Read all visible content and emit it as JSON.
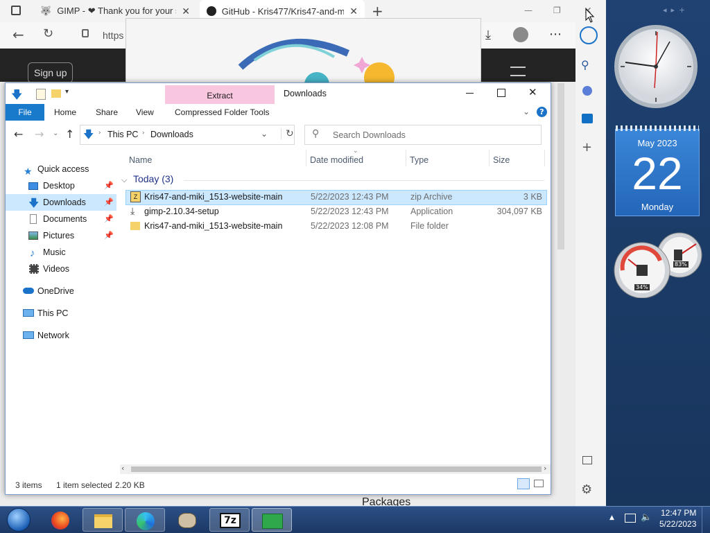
{
  "browser": {
    "tabs": [
      {
        "label": "GIMP - ❤ Thank you for your s",
        "close": "✕"
      },
      {
        "label": "GitHub - Kris477/Kris47-and-mi",
        "close": "✕"
      }
    ],
    "new_tab": "+",
    "address": "https",
    "sign_up": "Sign up",
    "packages_text": "Packages",
    "window_controls": {
      "minimize": "—",
      "restore": "❐",
      "close": "✕"
    }
  },
  "explorer": {
    "title": "Downloads",
    "context_tab": "Extract",
    "ribbon_tabs": [
      "File",
      "Home",
      "Share",
      "View",
      "Compressed Folder Tools"
    ],
    "breadcrumb": [
      "This PC",
      "Downloads"
    ],
    "search_placeholder": "Search Downloads",
    "nav": {
      "quick_access": "Quick access",
      "desktop": "Desktop",
      "downloads": "Downloads",
      "documents": "Documents",
      "pictures": "Pictures",
      "music": "Music",
      "videos": "Videos",
      "onedrive": "OneDrive",
      "this_pc": "This PC",
      "network": "Network"
    },
    "columns": {
      "name": "Name",
      "date": "Date modified",
      "type": "Type",
      "size": "Size"
    },
    "group_label": "Today (3)",
    "files": [
      {
        "name": "Kris47-and-miki_1513-website-main",
        "date": "5/22/2023 12:43 PM",
        "type": "zip Archive",
        "size": "3 KB",
        "icon": "zip-icon"
      },
      {
        "name": "gimp-2.10.34-setup",
        "date": "5/22/2023 12:43 PM",
        "type": "Application",
        "size": "304,097 KB",
        "icon": "installer-icon"
      },
      {
        "name": "Kris47-and-miki_1513-website-main",
        "date": "5/22/2023 12:08 PM",
        "type": "File folder",
        "size": "",
        "icon": "folder-icon"
      }
    ],
    "status": {
      "items": "3 items",
      "selected": "1 item selected",
      "size": "2.20 KB"
    }
  },
  "gadgets": {
    "calendar": {
      "month_year": "May 2023",
      "day": "22",
      "weekday": "Monday"
    },
    "meter": {
      "cpu": "34%",
      "memory": "83%"
    }
  },
  "taskbar": {
    "time": "12:47 PM",
    "date": "5/22/2023",
    "apps": [
      "start-orb",
      "firefox-icon",
      "file-explorer-icon",
      "edge-icon",
      "gimp-icon",
      "7zip-icon",
      "installer-icon"
    ],
    "sevenzip_label": "7z"
  },
  "colors": {
    "accent": "#0063b1",
    "selection": "#cce8ff",
    "calendar": "#2a72c9",
    "extract_tab": "#f8c6de"
  }
}
